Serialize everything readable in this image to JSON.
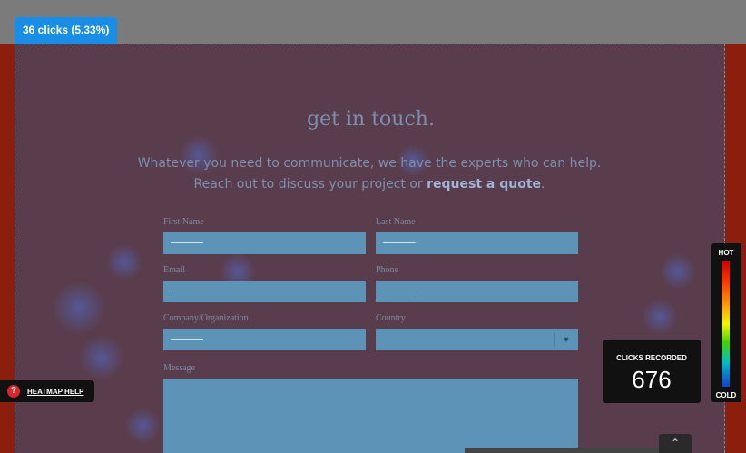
{
  "heatmap": {
    "clicks_badge": "36 clicks (5.33%)",
    "help_label": "HEATMAP HELP",
    "help_icon": "question-icon",
    "recorded_label": "CLICKS RECORDED",
    "recorded_value": "676",
    "legend_hot": "HOT",
    "legend_cold": "COLD",
    "overlay_color": "#5a3d4c",
    "badge_color": "#1a8ee6"
  },
  "page": {
    "title": "get in touch.",
    "intro_text": "Whatever you need to communicate, we have the experts who can help. Reach out to discuss your project or ",
    "intro_link": "request a quote",
    "intro_end": "."
  },
  "form": {
    "first_name": "First Name",
    "last_name": "Last Name",
    "email": "Email",
    "phone": "Phone",
    "company": "Company/Organization",
    "country": "Country",
    "message": "Message"
  }
}
